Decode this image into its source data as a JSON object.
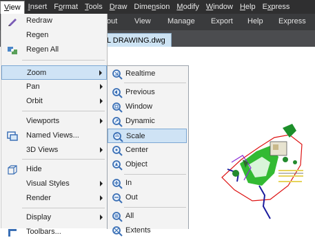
{
  "menubar": {
    "items": [
      {
        "label": "View",
        "u": "V"
      },
      {
        "label": "Insert",
        "u": "I"
      },
      {
        "label": "Format",
        "u": "o"
      },
      {
        "label": "Tools",
        "u": "T"
      },
      {
        "label": "Draw",
        "u": "D"
      },
      {
        "label": "Dimension",
        "u": "n"
      },
      {
        "label": "Modify",
        "u": "M"
      },
      {
        "label": "Window",
        "u": "W"
      },
      {
        "label": "Help",
        "u": "H"
      },
      {
        "label": "Express",
        "u": "x"
      }
    ]
  },
  "ribbon": {
    "tabs": [
      "out",
      "View",
      "Manage",
      "Export",
      "Help",
      "Express"
    ]
  },
  "filetab": {
    "label": "L DRAWING.dwg"
  },
  "view_menu": {
    "items": [
      {
        "label": "Redraw",
        "icon": "pencil-icon"
      },
      {
        "label": "Regen",
        "icon": ""
      },
      {
        "label": "Regen All",
        "icon": "regen-all-icon"
      },
      {
        "label": "Zoom",
        "icon": "",
        "submenu": true
      },
      {
        "label": "Pan",
        "icon": "",
        "submenu": true
      },
      {
        "label": "Orbit",
        "icon": "",
        "submenu": true
      },
      {
        "label": "Viewports",
        "icon": "",
        "submenu": true
      },
      {
        "label": "Named Views...",
        "icon": "named-views-icon"
      },
      {
        "label": "3D Views",
        "icon": "",
        "submenu": true
      },
      {
        "label": "Hide",
        "icon": "hide-icon"
      },
      {
        "label": "Visual Styles",
        "icon": "",
        "submenu": true
      },
      {
        "label": "Render",
        "icon": "",
        "submenu": true
      },
      {
        "label": "Display",
        "icon": "",
        "submenu": true
      },
      {
        "label": "Toolbars...",
        "icon": "toolbars-icon"
      }
    ]
  },
  "zoom_submenu": {
    "items": [
      {
        "label": "Realtime",
        "icon": "zoom-realtime-icon"
      },
      {
        "label": "Previous",
        "icon": "zoom-previous-icon"
      },
      {
        "label": "Window",
        "icon": "zoom-window-icon"
      },
      {
        "label": "Dynamic",
        "icon": "zoom-dynamic-icon"
      },
      {
        "label": "Scale",
        "icon": "zoom-scale-icon"
      },
      {
        "label": "Center",
        "icon": "zoom-center-icon"
      },
      {
        "label": "Object",
        "icon": "zoom-object-icon"
      },
      {
        "label": "In",
        "icon": "zoom-in-icon"
      },
      {
        "label": "Out",
        "icon": "zoom-out-icon"
      },
      {
        "label": "All",
        "icon": "zoom-all-icon"
      },
      {
        "label": "Extents",
        "icon": "zoom-extents-icon"
      }
    ]
  },
  "colors": {
    "menubar_bg": "#2f2f30",
    "menu_bg": "#f3f3f3",
    "highlight_bg": "#cfe3f5",
    "highlight_border": "#7ba7d4",
    "zoom_icon": "#3a6fb5"
  }
}
